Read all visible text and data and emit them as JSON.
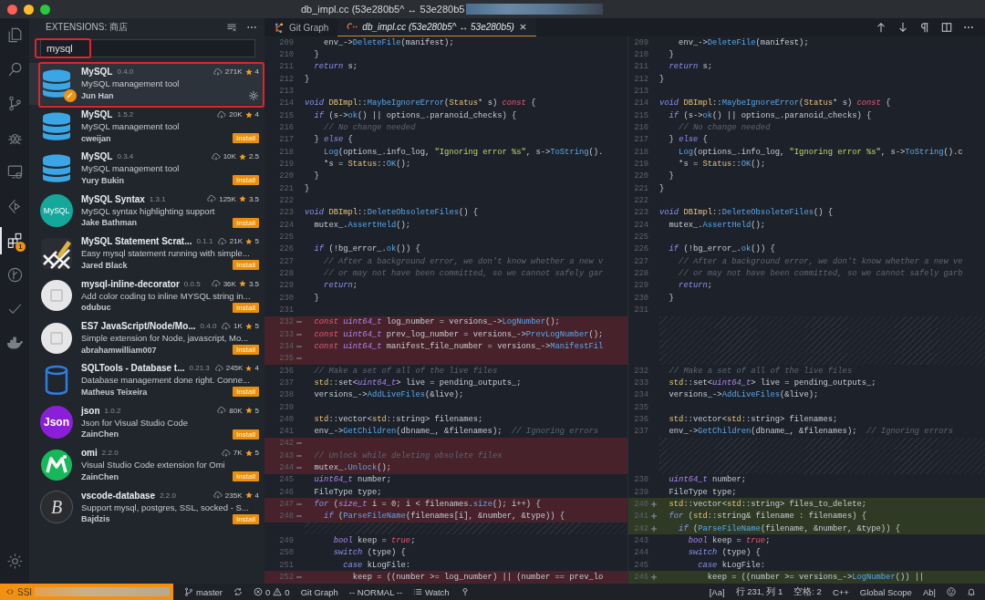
{
  "window": {
    "title": "db_impl.cc (53e280b5^ ↔ 53e280b5"
  },
  "activity_bar": {
    "items": [
      {
        "kind": "files",
        "selected": false
      },
      {
        "kind": "search",
        "selected": false
      },
      {
        "kind": "source-control",
        "selected": false
      },
      {
        "kind": "debug",
        "selected": false
      },
      {
        "kind": "remote",
        "selected": false
      },
      {
        "kind": "live-share",
        "selected": false
      },
      {
        "kind": "extensions",
        "selected": true,
        "badge": "1"
      },
      {
        "kind": "git-graph",
        "selected": false
      },
      {
        "kind": "check",
        "selected": false
      },
      {
        "kind": "docker",
        "selected": false
      }
    ]
  },
  "extensions": {
    "title": "EXTENSIONS: 商店",
    "search": {
      "value": "mysql",
      "highlighted": true
    },
    "items": [
      {
        "kind": "database",
        "name": "MySQL",
        "version": "0.4.0",
        "downloads": "271K",
        "rating": "4",
        "description": "MySQL management tool",
        "author": "Jun Han",
        "installed": true,
        "selected": true,
        "highlighted": true
      },
      {
        "kind": "database",
        "name": "MySQL",
        "version": "1.5.2",
        "downloads": "20K",
        "rating": "4",
        "description": "MySQL management tool",
        "author": "cweijan",
        "installed": false,
        "install_label": "Install",
        "selected": false,
        "highlighted": false
      },
      {
        "kind": "database",
        "name": "MySQL",
        "version": "0.3.4",
        "downloads": "10K",
        "rating": "2.5",
        "description": "MySQL management tool",
        "author": "Yury Bukin",
        "installed": false,
        "install_label": "Install",
        "selected": false,
        "highlighted": false
      },
      {
        "kind": "teal-circle",
        "logo_text": "MySQL",
        "name": "MySQL Syntax",
        "version": "1.3.1",
        "downloads": "125K",
        "rating": "3.5",
        "description": "MySQL syntax highlighting support",
        "author": "Jake Bathman",
        "installed": false,
        "install_label": "Install",
        "selected": false,
        "highlighted": false
      },
      {
        "kind": "pencil",
        "name": "MySQL Statement Scrat...",
        "version": "0.1.1",
        "downloads": "21K",
        "rating": "5",
        "description": "Easy mysql statement running with simple...",
        "author": "Jared Black",
        "installed": false,
        "install_label": "Install",
        "selected": false,
        "highlighted": false
      },
      {
        "kind": "placeholder",
        "name": "mysql-inline-decorator",
        "version": "0.0.5",
        "downloads": "36K",
        "rating": "3.5",
        "description": "Add color coding to inline MYSQL string in...",
        "author": "odubuc",
        "installed": false,
        "install_label": "Install",
        "selected": false,
        "highlighted": false
      },
      {
        "kind": "placeholder",
        "name": "ES7 JavaScript/Node/Mo...",
        "version": "0.4.0",
        "downloads": "1K",
        "rating": "5",
        "description": "Simple extension for Node, javascript, Mo...",
        "author": "abrahamwilliam007",
        "installed": false,
        "install_label": "Install",
        "selected": false,
        "highlighted": false
      },
      {
        "kind": "cylinder",
        "name": "SQLTools - Database t...",
        "version": "0.21.3",
        "downloads": "245K",
        "rating": "4",
        "description": "Database management done right. Conne...",
        "author": "Matheus Teixeira",
        "installed": false,
        "install_label": "Install",
        "selected": false,
        "highlighted": false
      },
      {
        "kind": "purple-circle",
        "logo_text": "Json",
        "name": "json",
        "version": "1.0.2",
        "downloads": "80K",
        "rating": "5",
        "description": "Json for Visual Studio Code",
        "author": "ZainChen",
        "installed": false,
        "install_label": "Install",
        "selected": false,
        "highlighted": false
      },
      {
        "kind": "green-m",
        "name": "omi",
        "version": "2.2.0",
        "downloads": "7K",
        "rating": "5",
        "description": "Visual Studio Code extension for Omi",
        "author": "ZainChen",
        "installed": false,
        "install_label": "Install",
        "selected": false,
        "highlighted": false
      },
      {
        "kind": "dark-circle",
        "logo_text": "B",
        "name": "vscode-database",
        "version": "2.2.0",
        "downloads": "235K",
        "rating": "4",
        "description": "Support mysql, postgres, SSL, socked - S...",
        "author": "Bajdzis",
        "installed": false,
        "install_label": "Install",
        "selected": false,
        "highlighted": false
      }
    ]
  },
  "tabs": [
    {
      "kind": "git-graph",
      "label": "Git Graph",
      "selected": false
    },
    {
      "kind": "cpp",
      "label": "db_impl.cc (53e280b5^ ↔ 53e280b5)",
      "selected": true
    }
  ],
  "editor": {
    "panes": [
      {
        "lines": [
          {
            "kind": "context",
            "num": "209",
            "code": [
              {
                "kind": "pl",
                "text": "    env_->"
              },
              {
                "kind": "fn",
                "text": "DeleteFile"
              },
              {
                "kind": "pl",
                "text": "(manifest);"
              }
            ]
          },
          {
            "kind": "context",
            "num": "210",
            "code": [
              {
                "kind": "pl",
                "text": "  }"
              }
            ]
          },
          {
            "kind": "context",
            "num": "211",
            "code": [
              {
                "kind": "kw",
                "text": "  return"
              },
              {
                "kind": "pl",
                "text": " s;"
              }
            ]
          },
          {
            "kind": "context",
            "num": "212",
            "code": [
              {
                "kind": "pl",
                "text": "}"
              }
            ]
          },
          {
            "kind": "context",
            "num": "213"
          },
          {
            "kind": "context",
            "num": "214",
            "code": [
              {
                "kind": "kw",
                "text": "void"
              },
              {
                "kind": "cls",
                "text": " DBImpl"
              },
              {
                "kind": "pl",
                "text": "::"
              },
              {
                "kind": "fn",
                "text": "MaybeIgnoreError"
              },
              {
                "kind": "pl",
                "text": "("
              },
              {
                "kind": "cls",
                "text": "Status"
              },
              {
                "kind": "pl",
                "text": "* s) "
              },
              {
                "kind": "lit",
                "text": "const"
              },
              {
                "kind": "pl",
                "text": " {"
              }
            ]
          },
          {
            "kind": "context",
            "num": "215",
            "code": [
              {
                "kind": "kw",
                "text": "  if"
              },
              {
                "kind": "pl",
                "text": " (s->"
              },
              {
                "kind": "fn",
                "text": "ok"
              },
              {
                "kind": "pl",
                "text": "() || options_.paranoid_checks) {"
              }
            ]
          },
          {
            "kind": "context",
            "num": "216",
            "code": [
              {
                "kind": "cm",
                "text": "    // No change needed"
              }
            ]
          },
          {
            "kind": "context",
            "num": "217",
            "code": [
              {
                "kind": "pl",
                "text": "  } "
              },
              {
                "kind": "kw",
                "text": "else"
              },
              {
                "kind": "pl",
                "text": " {"
              }
            ]
          },
          {
            "kind": "context",
            "num": "218",
            "code": [
              {
                "kind": "fn",
                "text": "    Log"
              },
              {
                "kind": "pl",
                "text": "(options_.info_log, "
              },
              {
                "kind": "str",
                "text": "\"Ignoring error %s\""
              },
              {
                "kind": "pl",
                "text": ", s->"
              },
              {
                "kind": "fn",
                "text": "ToString"
              },
              {
                "kind": "pl",
                "text": "()."
              }
            ]
          },
          {
            "kind": "context",
            "num": "219",
            "code": [
              {
                "kind": "pl",
                "text": "    *s = "
              },
              {
                "kind": "cls",
                "text": "Status"
              },
              {
                "kind": "pl",
                "text": "::"
              },
              {
                "kind": "fn",
                "text": "OK"
              },
              {
                "kind": "pl",
                "text": "();"
              }
            ]
          },
          {
            "kind": "context",
            "num": "220",
            "code": [
              {
                "kind": "pl",
                "text": "  }"
              }
            ]
          },
          {
            "kind": "context",
            "num": "221",
            "code": [
              {
                "kind": "pl",
                "text": "}"
              }
            ]
          },
          {
            "kind": "context",
            "num": "222"
          },
          {
            "kind": "context",
            "num": "223",
            "code": [
              {
                "kind": "kw",
                "text": "void"
              },
              {
                "kind": "cls",
                "text": " DBImpl"
              },
              {
                "kind": "pl",
                "text": "::"
              },
              {
                "kind": "fn",
                "text": "DeleteObsoleteFiles"
              },
              {
                "kind": "pl",
                "text": "() {"
              }
            ]
          },
          {
            "kind": "context",
            "num": "224",
            "code": [
              {
                "kind": "pl",
                "text": "  mutex_."
              },
              {
                "kind": "fn",
                "text": "AssertHeld"
              },
              {
                "kind": "pl",
                "text": "();"
              }
            ]
          },
          {
            "kind": "context",
            "num": "225"
          },
          {
            "kind": "context",
            "num": "226",
            "code": [
              {
                "kind": "kw",
                "text": "  if"
              },
              {
                "kind": "pl",
                "text": " (!bg_error_."
              },
              {
                "kind": "fn",
                "text": "ok"
              },
              {
                "kind": "pl",
                "text": "()) {"
              }
            ]
          },
          {
            "kind": "context",
            "num": "227",
            "code": [
              {
                "kind": "cm",
                "text": "    // After a background error, we don't know whether a new v"
              }
            ]
          },
          {
            "kind": "context",
            "num": "228",
            "code": [
              {
                "kind": "cm",
                "text": "    // or may not have been committed, so we cannot safely gar"
              }
            ]
          },
          {
            "kind": "context",
            "num": "229",
            "code": [
              {
                "kind": "kw",
                "text": "    return"
              },
              {
                "kind": "pl",
                "text": ";"
              }
            ]
          },
          {
            "kind": "context",
            "num": "230",
            "code": [
              {
                "kind": "pl",
                "text": "  }"
              }
            ]
          },
          {
            "kind": "context",
            "num": "231"
          },
          {
            "kind": "removed",
            "num": "232",
            "code": [
              {
                "kind": "lit",
                "text": "  const"
              },
              {
                "kind": "ty",
                "text": " uint64_t"
              },
              {
                "kind": "pl",
                "text": " log_number = versions_->"
              },
              {
                "kind": "fn",
                "text": "LogNumber"
              },
              {
                "kind": "pl",
                "text": "();"
              }
            ]
          },
          {
            "kind": "removed",
            "num": "233",
            "code": [
              {
                "kind": "lit",
                "text": "  const"
              },
              {
                "kind": "ty",
                "text": " uint64_t"
              },
              {
                "kind": "pl",
                "text": " prev_log_number = versions_->"
              },
              {
                "kind": "fn",
                "text": "PrevLogNumber"
              },
              {
                "kind": "pl",
                "text": "();"
              }
            ]
          },
          {
            "kind": "removed",
            "num": "234",
            "code": [
              {
                "kind": "lit",
                "text": "  const"
              },
              {
                "kind": "ty",
                "text": " uint64_t"
              },
              {
                "kind": "pl",
                "text": " manifest_file_number = versions_->"
              },
              {
                "kind": "fn",
                "text": "ManifestFil"
              }
            ]
          },
          {
            "kind": "removed",
            "num": "235"
          },
          {
            "kind": "context",
            "num": "236",
            "code": [
              {
                "kind": "cm",
                "text": "  // Make a set of all of the live files"
              }
            ]
          },
          {
            "kind": "context",
            "num": "237",
            "code": [
              {
                "kind": "cls",
                "text": "  std"
              },
              {
                "kind": "pl",
                "text": "::set<"
              },
              {
                "kind": "ty",
                "text": "uint64_t"
              },
              {
                "kind": "pl",
                "text": "> live = pending_outputs_;"
              }
            ]
          },
          {
            "kind": "context",
            "num": "238",
            "code": [
              {
                "kind": "pl",
                "text": "  versions_->"
              },
              {
                "kind": "fn",
                "text": "AddLiveFiles"
              },
              {
                "kind": "pl",
                "text": "(&live);"
              }
            ]
          },
          {
            "kind": "context",
            "num": "239"
          },
          {
            "kind": "context",
            "num": "240",
            "code": [
              {
                "kind": "cls",
                "text": "  std"
              },
              {
                "kind": "pl",
                "text": "::vector<"
              },
              {
                "kind": "cls",
                "text": "std"
              },
              {
                "kind": "pl",
                "text": "::string> filenames;"
              }
            ]
          },
          {
            "kind": "context",
            "num": "241",
            "code": [
              {
                "kind": "pl",
                "text": "  env_->"
              },
              {
                "kind": "fn",
                "text": "GetChildren"
              },
              {
                "kind": "pl",
                "text": "(dbname_, &filenames);"
              },
              {
                "kind": "cm",
                "text": "  // Ignoring errors"
              }
            ]
          },
          {
            "kind": "removed",
            "num": "242"
          },
          {
            "kind": "removed",
            "num": "243",
            "code": [
              {
                "kind": "cm",
                "text": "  // Unlock while deleting obsolete files"
              }
            ]
          },
          {
            "kind": "removed",
            "num": "244",
            "code": [
              {
                "kind": "pl",
                "text": "  mutex_."
              },
              {
                "kind": "fn",
                "text": "Unlock"
              },
              {
                "kind": "pl",
                "text": "();"
              }
            ]
          },
          {
            "kind": "context",
            "num": "245",
            "code": [
              {
                "kind": "ty",
                "text": "  uint64_t"
              },
              {
                "kind": "pl",
                "text": " number;"
              }
            ]
          },
          {
            "kind": "context",
            "num": "246",
            "code": [
              {
                "kind": "pl",
                "text": "  FileType type;"
              }
            ]
          },
          {
            "kind": "removed",
            "num": "247",
            "code": [
              {
                "kind": "kw",
                "text": "  for"
              },
              {
                "kind": "pl",
                "text": " ("
              },
              {
                "kind": "ty",
                "text": "size_t"
              },
              {
                "kind": "pl",
                "text": " i = 0; i < filenames."
              },
              {
                "kind": "fn",
                "text": "size"
              },
              {
                "kind": "pl",
                "text": "(); i++) {"
              }
            ]
          },
          {
            "kind": "removed",
            "num": "248",
            "code": [
              {
                "kind": "kw",
                "text": "    if"
              },
              {
                "kind": "pl",
                "text": " ("
              },
              {
                "kind": "fn",
                "text": "ParseFileName"
              },
              {
                "kind": "pl",
                "text": "(filenames[i], &number, &type)) {"
              }
            ]
          },
          {
            "kind": "filler"
          },
          {
            "kind": "context",
            "num": "249",
            "code": [
              {
                "kind": "ty",
                "text": "      bool"
              },
              {
                "kind": "pl",
                "text": " keep = "
              },
              {
                "kind": "lit",
                "text": "true"
              },
              {
                "kind": "pl",
                "text": ";"
              }
            ]
          },
          {
            "kind": "context",
            "num": "250",
            "code": [
              {
                "kind": "kw",
                "text": "      switch"
              },
              {
                "kind": "pl",
                "text": " (type) {"
              }
            ]
          },
          {
            "kind": "context",
            "num": "251",
            "code": [
              {
                "kind": "kw",
                "text": "        case"
              },
              {
                "kind": "pl",
                "text": " kLogFile:"
              }
            ]
          },
          {
            "kind": "removed",
            "num": "252",
            "code": [
              {
                "kind": "pl",
                "text": "          keep = ((number >= log_number) || (number == prev_lo"
              }
            ]
          }
        ]
      },
      {
        "lines": [
          {
            "kind": "context",
            "num": "209",
            "code": [
              {
                "kind": "pl",
                "text": "    env_->"
              },
              {
                "kind": "fn",
                "text": "DeleteFile"
              },
              {
                "kind": "pl",
                "text": "(manifest);"
              }
            ]
          },
          {
            "kind": "context",
            "num": "210",
            "code": [
              {
                "kind": "pl",
                "text": "  }"
              }
            ]
          },
          {
            "kind": "context",
            "num": "211",
            "code": [
              {
                "kind": "kw",
                "text": "  return"
              },
              {
                "kind": "pl",
                "text": " s;"
              }
            ]
          },
          {
            "kind": "context",
            "num": "212",
            "code": [
              {
                "kind": "pl",
                "text": "}"
              }
            ]
          },
          {
            "kind": "context",
            "num": "213"
          },
          {
            "kind": "context",
            "num": "214",
            "code": [
              {
                "kind": "kw",
                "text": "void"
              },
              {
                "kind": "cls",
                "text": " DBImpl"
              },
              {
                "kind": "pl",
                "text": "::"
              },
              {
                "kind": "fn",
                "text": "MaybeIgnoreError"
              },
              {
                "kind": "pl",
                "text": "("
              },
              {
                "kind": "cls",
                "text": "Status"
              },
              {
                "kind": "pl",
                "text": "* s) "
              },
              {
                "kind": "lit",
                "text": "const"
              },
              {
                "kind": "pl",
                "text": " {"
              }
            ]
          },
          {
            "kind": "context",
            "num": "215",
            "code": [
              {
                "kind": "kw",
                "text": "  if"
              },
              {
                "kind": "pl",
                "text": " (s->"
              },
              {
                "kind": "fn",
                "text": "ok"
              },
              {
                "kind": "pl",
                "text": "() || options_.paranoid_checks) {"
              }
            ]
          },
          {
            "kind": "context",
            "num": "216",
            "code": [
              {
                "kind": "cm",
                "text": "    // No change needed"
              }
            ]
          },
          {
            "kind": "context",
            "num": "217",
            "code": [
              {
                "kind": "pl",
                "text": "  } "
              },
              {
                "kind": "kw",
                "text": "else"
              },
              {
                "kind": "pl",
                "text": " {"
              }
            ]
          },
          {
            "kind": "context",
            "num": "218",
            "code": [
              {
                "kind": "fn",
                "text": "    Log"
              },
              {
                "kind": "pl",
                "text": "(options_.info_log, "
              },
              {
                "kind": "str",
                "text": "\"Ignoring error %s\""
              },
              {
                "kind": "pl",
                "text": ", s->"
              },
              {
                "kind": "fn",
                "text": "ToString"
              },
              {
                "kind": "pl",
                "text": "().c"
              }
            ]
          },
          {
            "kind": "context",
            "num": "219",
            "code": [
              {
                "kind": "pl",
                "text": "    *s = "
              },
              {
                "kind": "cls",
                "text": "Status"
              },
              {
                "kind": "pl",
                "text": "::"
              },
              {
                "kind": "fn",
                "text": "OK"
              },
              {
                "kind": "pl",
                "text": "();"
              }
            ]
          },
          {
            "kind": "context",
            "num": "220",
            "code": [
              {
                "kind": "pl",
                "text": "  }"
              }
            ]
          },
          {
            "kind": "context",
            "num": "221",
            "code": [
              {
                "kind": "pl",
                "text": "}"
              }
            ]
          },
          {
            "kind": "context",
            "num": "222"
          },
          {
            "kind": "context",
            "num": "223",
            "code": [
              {
                "kind": "kw",
                "text": "void"
              },
              {
                "kind": "cls",
                "text": " DBImpl"
              },
              {
                "kind": "pl",
                "text": "::"
              },
              {
                "kind": "fn",
                "text": "DeleteObsoleteFiles"
              },
              {
                "kind": "pl",
                "text": "() {"
              }
            ]
          },
          {
            "kind": "context",
            "num": "224",
            "code": [
              {
                "kind": "pl",
                "text": "  mutex_."
              },
              {
                "kind": "fn",
                "text": "AssertHeld"
              },
              {
                "kind": "pl",
                "text": "();"
              }
            ]
          },
          {
            "kind": "context",
            "num": "225"
          },
          {
            "kind": "context",
            "num": "226",
            "code": [
              {
                "kind": "kw",
                "text": "  if"
              },
              {
                "kind": "pl",
                "text": " (!bg_error_."
              },
              {
                "kind": "fn",
                "text": "ok"
              },
              {
                "kind": "pl",
                "text": "()) {"
              }
            ]
          },
          {
            "kind": "context",
            "num": "227",
            "code": [
              {
                "kind": "cm",
                "text": "    // After a background error, we don't know whether a new ve"
              }
            ]
          },
          {
            "kind": "context",
            "num": "228",
            "code": [
              {
                "kind": "cm",
                "text": "    // or may not have been committed, so we cannot safely garb"
              }
            ]
          },
          {
            "kind": "context",
            "num": "229",
            "code": [
              {
                "kind": "kw",
                "text": "    return"
              },
              {
                "kind": "pl",
                "text": ";"
              }
            ]
          },
          {
            "kind": "context",
            "num": "230",
            "code": [
              {
                "kind": "pl",
                "text": "  }"
              }
            ]
          },
          {
            "kind": "context",
            "num": "231"
          },
          {
            "kind": "filler"
          },
          {
            "kind": "filler"
          },
          {
            "kind": "filler"
          },
          {
            "kind": "filler"
          },
          {
            "kind": "context",
            "num": "232",
            "code": [
              {
                "kind": "cm",
                "text": "  // Make a set of all of the live files"
              }
            ]
          },
          {
            "kind": "context",
            "num": "233",
            "code": [
              {
                "kind": "cls",
                "text": "  std"
              },
              {
                "kind": "pl",
                "text": "::set<"
              },
              {
                "kind": "ty",
                "text": "uint64_t"
              },
              {
                "kind": "pl",
                "text": "> live = pending_outputs_;"
              }
            ]
          },
          {
            "kind": "context",
            "num": "234",
            "code": [
              {
                "kind": "pl",
                "text": "  versions_->"
              },
              {
                "kind": "fn",
                "text": "AddLiveFiles"
              },
              {
                "kind": "pl",
                "text": "(&live);"
              }
            ]
          },
          {
            "kind": "context",
            "num": "235"
          },
          {
            "kind": "context",
            "num": "236",
            "code": [
              {
                "kind": "cls",
                "text": "  std"
              },
              {
                "kind": "pl",
                "text": "::vector<"
              },
              {
                "kind": "cls",
                "text": "std"
              },
              {
                "kind": "pl",
                "text": "::string> filenames;"
              }
            ]
          },
          {
            "kind": "context",
            "num": "237",
            "code": [
              {
                "kind": "pl",
                "text": "  env_->"
              },
              {
                "kind": "fn",
                "text": "GetChildren"
              },
              {
                "kind": "pl",
                "text": "(dbname_, &filenames);"
              },
              {
                "kind": "cm",
                "text": "  // Ignoring errors"
              }
            ]
          },
          {
            "kind": "filler"
          },
          {
            "kind": "filler"
          },
          {
            "kind": "filler"
          },
          {
            "kind": "context",
            "num": "238",
            "code": [
              {
                "kind": "ty",
                "text": "  uint64_t"
              },
              {
                "kind": "pl",
                "text": " number;"
              }
            ]
          },
          {
            "kind": "context",
            "num": "239",
            "code": [
              {
                "kind": "pl",
                "text": "  FileType type;"
              }
            ]
          },
          {
            "kind": "added",
            "num": "240",
            "code": [
              {
                "kind": "cls",
                "text": "  std"
              },
              {
                "kind": "pl",
                "text": "::vector<"
              },
              {
                "kind": "cls",
                "text": "std"
              },
              {
                "kind": "pl",
                "text": "::string> files_to_delete;"
              }
            ]
          },
          {
            "kind": "added",
            "num": "241",
            "code": [
              {
                "kind": "kw",
                "text": "  for"
              },
              {
                "kind": "pl",
                "text": " ("
              },
              {
                "kind": "cls",
                "text": "std"
              },
              {
                "kind": "pl",
                "text": "::string& filename : filenames) {"
              }
            ]
          },
          {
            "kind": "added",
            "num": "242",
            "code": [
              {
                "kind": "kw",
                "text": "    if"
              },
              {
                "kind": "pl",
                "text": " ("
              },
              {
                "kind": "fn",
                "text": "ParseFileName"
              },
              {
                "kind": "pl",
                "text": "(filename, &number, &type)) {"
              }
            ]
          },
          {
            "kind": "context",
            "num": "243",
            "code": [
              {
                "kind": "ty",
                "text": "      bool"
              },
              {
                "kind": "pl",
                "text": " keep = "
              },
              {
                "kind": "lit",
                "text": "true"
              },
              {
                "kind": "pl",
                "text": ";"
              }
            ]
          },
          {
            "kind": "context",
            "num": "244",
            "code": [
              {
                "kind": "kw",
                "text": "      switch"
              },
              {
                "kind": "pl",
                "text": " (type) {"
              }
            ]
          },
          {
            "kind": "context",
            "num": "245",
            "code": [
              {
                "kind": "kw",
                "text": "        case"
              },
              {
                "kind": "pl",
                "text": " kLogFile:"
              }
            ]
          },
          {
            "kind": "added",
            "num": "246",
            "code": [
              {
                "kind": "pl",
                "text": "          keep = ((number >= versions_->"
              },
              {
                "kind": "fn",
                "text": "LogNumber"
              },
              {
                "kind": "pl",
                "text": "()) ||"
              }
            ]
          }
        ]
      }
    ]
  },
  "status_bar": {
    "remote": "SSI",
    "left": [
      {
        "kind": "branch",
        "text": "master"
      },
      {
        "kind": "sync"
      },
      {
        "kind": "problems",
        "errors": "0",
        "warnings": "0"
      },
      {
        "kind": "text",
        "text": "Git Graph"
      },
      {
        "kind": "text",
        "text": "-- NORMAL --"
      },
      {
        "kind": "watch",
        "text": "Watch"
      },
      {
        "kind": "pin"
      }
    ],
    "right": [
      {
        "kind": "text",
        "text": "[Aa]"
      },
      {
        "kind": "text",
        "text": "行 231, 列 1"
      },
      {
        "kind": "text",
        "text": "空格: 2"
      },
      {
        "kind": "text",
        "text": "C++"
      },
      {
        "kind": "text",
        "text": "Global Scope"
      },
      {
        "kind": "text",
        "text": "Ab|"
      },
      {
        "kind": "feedback"
      },
      {
        "kind": "bell"
      }
    ]
  }
}
